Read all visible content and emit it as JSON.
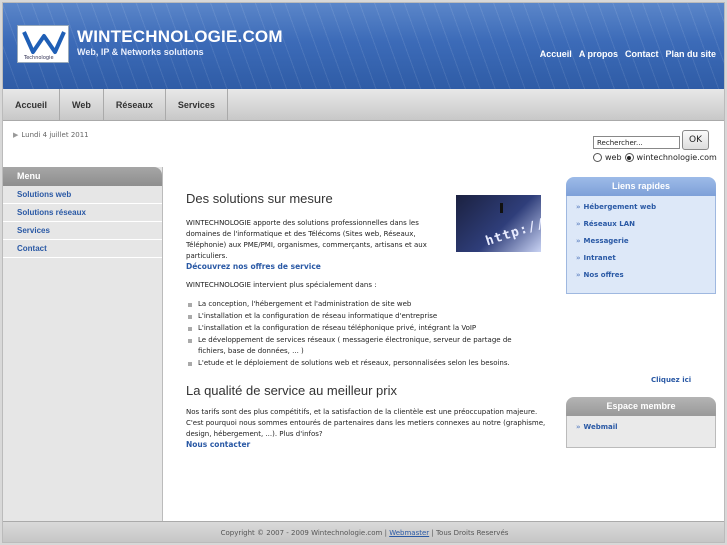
{
  "header": {
    "logo_text": "Technologie",
    "title": "WINTECHNOLOGIE.COM",
    "tagline": "Web, IP & Networks solutions",
    "top_nav": [
      "Accueil",
      "A propos",
      "Contact",
      "Plan du site"
    ],
    "accent": "#3c6bb8"
  },
  "tabs": [
    "Accueil",
    "Web",
    "Réseaux",
    "Services"
  ],
  "date": "Lundi 4 juillet 2011",
  "search": {
    "value": "Rechercher...",
    "button": "OK",
    "options": [
      "web",
      "wintechnologie.com"
    ],
    "selected": "wintechnologie.com"
  },
  "menu": {
    "title": "Menu",
    "items": [
      "Solutions web",
      "Solutions réseaux",
      "Services",
      "Contact"
    ]
  },
  "main": {
    "section1": {
      "title": "Des solutions sur mesure",
      "paragraph": "WINTECHNOLOGIE apporte des solutions professionnelles dans les domaines de l'informatique et des Télécoms (Sites web, Réseaux, Téléphonie) aux PME/PMI, organismes, commerçants, artisans et aux particuliers.",
      "link": "Découvrez nos offres de service",
      "intro": "WINTECHNOLOGIE intervient plus spécialement dans :",
      "bullets": [
        "La conception, l'hébergement et l'administration de site web",
        "L'installation et la configuration de réseau informatique d'entreprise",
        "L'installation et la configuration de réseau téléphonique privé, intégrant la VoIP",
        "Le développement de services réseaux ( messagerie électronique, serveur de partage de fichiers, base de données, ... )",
        "L'etude et le déploiement de solutions web et réseaux, personnalisées selon les besoins."
      ],
      "photo_text": "http://www"
    },
    "section2": {
      "title": "La qualité de service au meilleur prix",
      "paragraph": "Nos tarifs sont des plus compétitifs, et la satisfaction de la clientèle est une préoccupation majeure. C'est pourquoi nous sommes entourés de partenaires dans les metiers connexes au notre (graphisme, design, hébergement, ...). Plus d'infos?",
      "link": "Nous contacter"
    }
  },
  "quick_links": {
    "title": "Liens rapides",
    "items": [
      "Hébergement web",
      "Réseaux LAN",
      "Messagerie",
      "Intranet",
      "Nos offres"
    ]
  },
  "cliquez": "Cliquez ici",
  "member": {
    "title": "Espace membre",
    "items": [
      "Webmail"
    ]
  },
  "footer": {
    "copyright": "Copyright © 2007 - 2009 Wintechnologie.com |",
    "webmaster": "Webmaster",
    "rights": "| Tous Droits Reservés"
  }
}
